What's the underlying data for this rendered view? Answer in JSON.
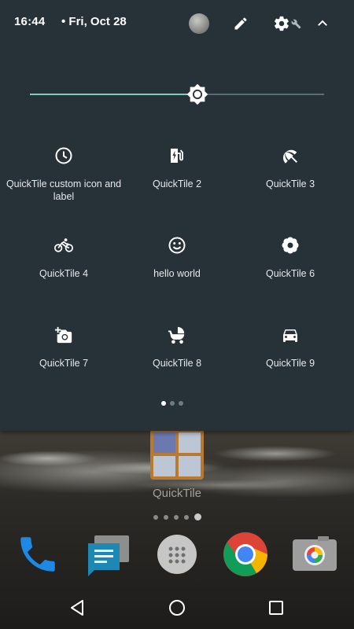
{
  "status_bar": {
    "time": "16:44",
    "date": "• Fri, Oct 28",
    "icons": [
      "avatar",
      "edit-icon",
      "settings-icon",
      "wrench-icon",
      "collapse-chevron-icon"
    ]
  },
  "brightness": {
    "level": 0.57,
    "track_color": "#5b6b72",
    "fill_color": "#80cbc4"
  },
  "tiles": [
    {
      "label": "QuickTile custom icon and label",
      "icon": "clock-icon"
    },
    {
      "label": "QuickTile 2",
      "icon": "ev-charger-icon"
    },
    {
      "label": "QuickTile 3",
      "icon": "beach-umbrella-icon"
    },
    {
      "label": "QuickTile 4",
      "icon": "bike-icon"
    },
    {
      "label": "hello world",
      "icon": "smiley-icon"
    },
    {
      "label": "QuickTile 6",
      "icon": "flower-icon"
    },
    {
      "label": "QuickTile 7",
      "icon": "add-photo-icon"
    },
    {
      "label": "QuickTile 8",
      "icon": "stroller-icon"
    },
    {
      "label": "QuickTile 9",
      "icon": "car-icon"
    }
  ],
  "qs_pages": {
    "count": 3,
    "active": 0
  },
  "home": {
    "folder_label": "QuickTile",
    "page_dots": {
      "count": 5,
      "active": 4
    },
    "dock": [
      "phone-icon",
      "messages-icon",
      "app-drawer-icon",
      "chrome-icon",
      "camera-icon"
    ]
  },
  "nav": [
    "back-icon",
    "home-icon",
    "recents-icon"
  ],
  "colors": {
    "shade": "#263238",
    "accent": "#80cbc4"
  }
}
